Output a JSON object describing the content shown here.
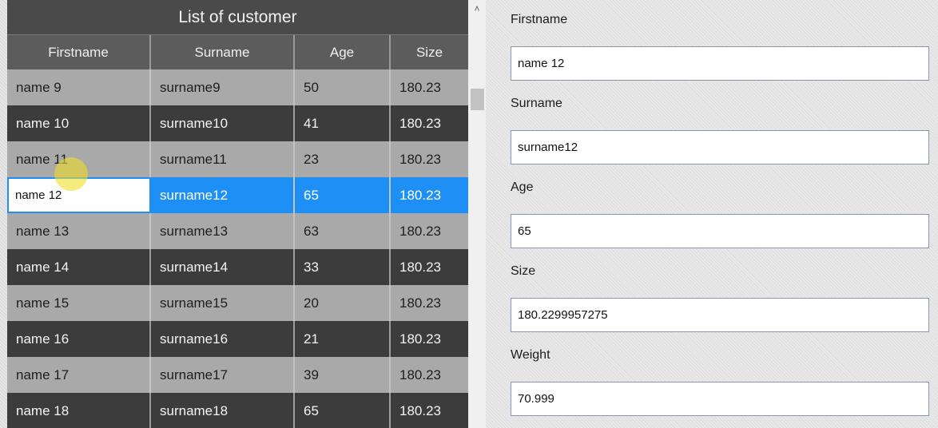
{
  "grid": {
    "title": "List of customer",
    "columns": [
      "Firstname",
      "Surname",
      "Age",
      "Size"
    ],
    "rows": [
      {
        "firstname": "name 9",
        "surname": "surname9",
        "age": "50",
        "size": "180.23"
      },
      {
        "firstname": "name 10",
        "surname": "surname10",
        "age": "41",
        "size": "180.23"
      },
      {
        "firstname": "name 11",
        "surname": "surname11",
        "age": "23",
        "size": "180.23"
      },
      {
        "firstname": "name 12",
        "surname": "surname12",
        "age": "65",
        "size": "180.23"
      },
      {
        "firstname": "name 13",
        "surname": "surname13",
        "age": "63",
        "size": "180.23"
      },
      {
        "firstname": "name 14",
        "surname": "surname14",
        "age": "33",
        "size": "180.23"
      },
      {
        "firstname": "name 15",
        "surname": "surname15",
        "age": "20",
        "size": "180.23"
      },
      {
        "firstname": "name 16",
        "surname": "surname16",
        "age": "21",
        "size": "180.23"
      },
      {
        "firstname": "name 17",
        "surname": "surname17",
        "age": "39",
        "size": "180.23"
      },
      {
        "firstname": "name 18",
        "surname": "surname18",
        "age": "65",
        "size": "180.23"
      }
    ],
    "selected_row": 3,
    "editing_value": "name 12"
  },
  "scrollbar": {
    "up_icon": "chevron-up-icon",
    "up_glyph": "˄"
  },
  "form": {
    "firstname_label": "Firstname",
    "firstname_value": "name 12",
    "surname_label": "Surname",
    "surname_value": "surname12",
    "age_label": "Age",
    "age_value": "65",
    "size_label": "Size",
    "size_value": "180.2299957275",
    "weight_label": "Weight",
    "weight_value": "70.999"
  },
  "colors": {
    "title_bg": "#4a4a4a",
    "header_bg": "#5c5c5c",
    "row_light": "#a9a9a9",
    "row_dark": "#3c3c3c",
    "selected": "#1e90f5"
  }
}
